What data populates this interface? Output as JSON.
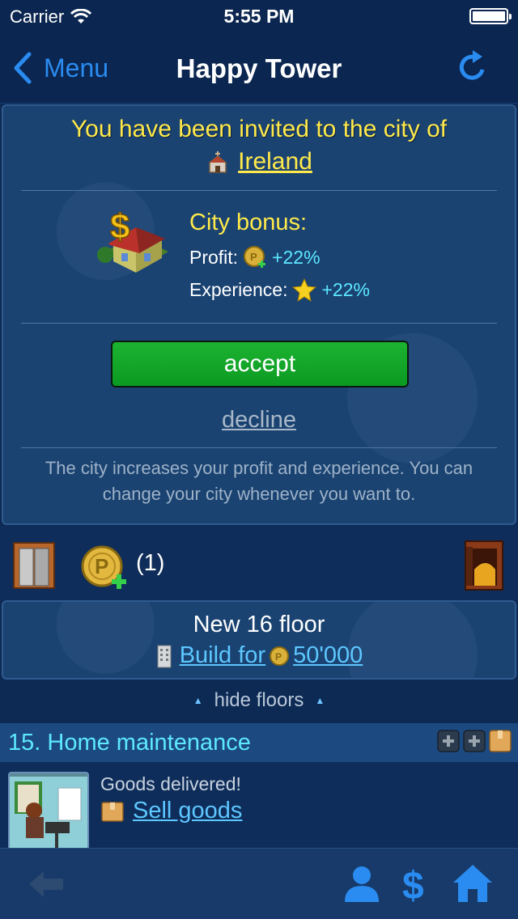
{
  "status_bar": {
    "carrier": "Carrier",
    "time": "5:55 PM"
  },
  "nav": {
    "back_label": "Menu",
    "title": "Happy Tower"
  },
  "invite": {
    "title": "You have been invited to the city of",
    "city": "Ireland",
    "bonus_title": "City bonus:",
    "profit_label": "Profit:",
    "profit_value": "+22%",
    "experience_label": "Experience:",
    "experience_value": "+22%",
    "accept_label": "accept",
    "decline_label": "decline",
    "note": "The city increases your profit and experience. You can change your city whenever you want to."
  },
  "tools": {
    "coin_count": "(1)"
  },
  "new_floor": {
    "title": "New 16 floor",
    "build_label": "Build for ",
    "build_price": "50'000"
  },
  "hide_floors_label": "hide floors",
  "floor": {
    "name": "15. Home maintenance",
    "status": "Goods delivered!",
    "action_label": "Sell goods"
  },
  "colors": {
    "accent": "#2a8cf0",
    "yellow": "#ffe94a",
    "cyan": "#5de8ff",
    "accept": "#13a82a"
  },
  "icons": [
    "wifi-icon",
    "battery-icon",
    "back-chevron-icon",
    "refresh-icon",
    "church-icon",
    "house-dollar-icon",
    "coin-plus-icon",
    "star-icon",
    "elevator-icon",
    "coin-icon",
    "vault-icon",
    "building-icon",
    "box-icon",
    "plus-icon",
    "back-arrow-icon",
    "user-icon",
    "dollar-icon",
    "home-icon"
  ]
}
